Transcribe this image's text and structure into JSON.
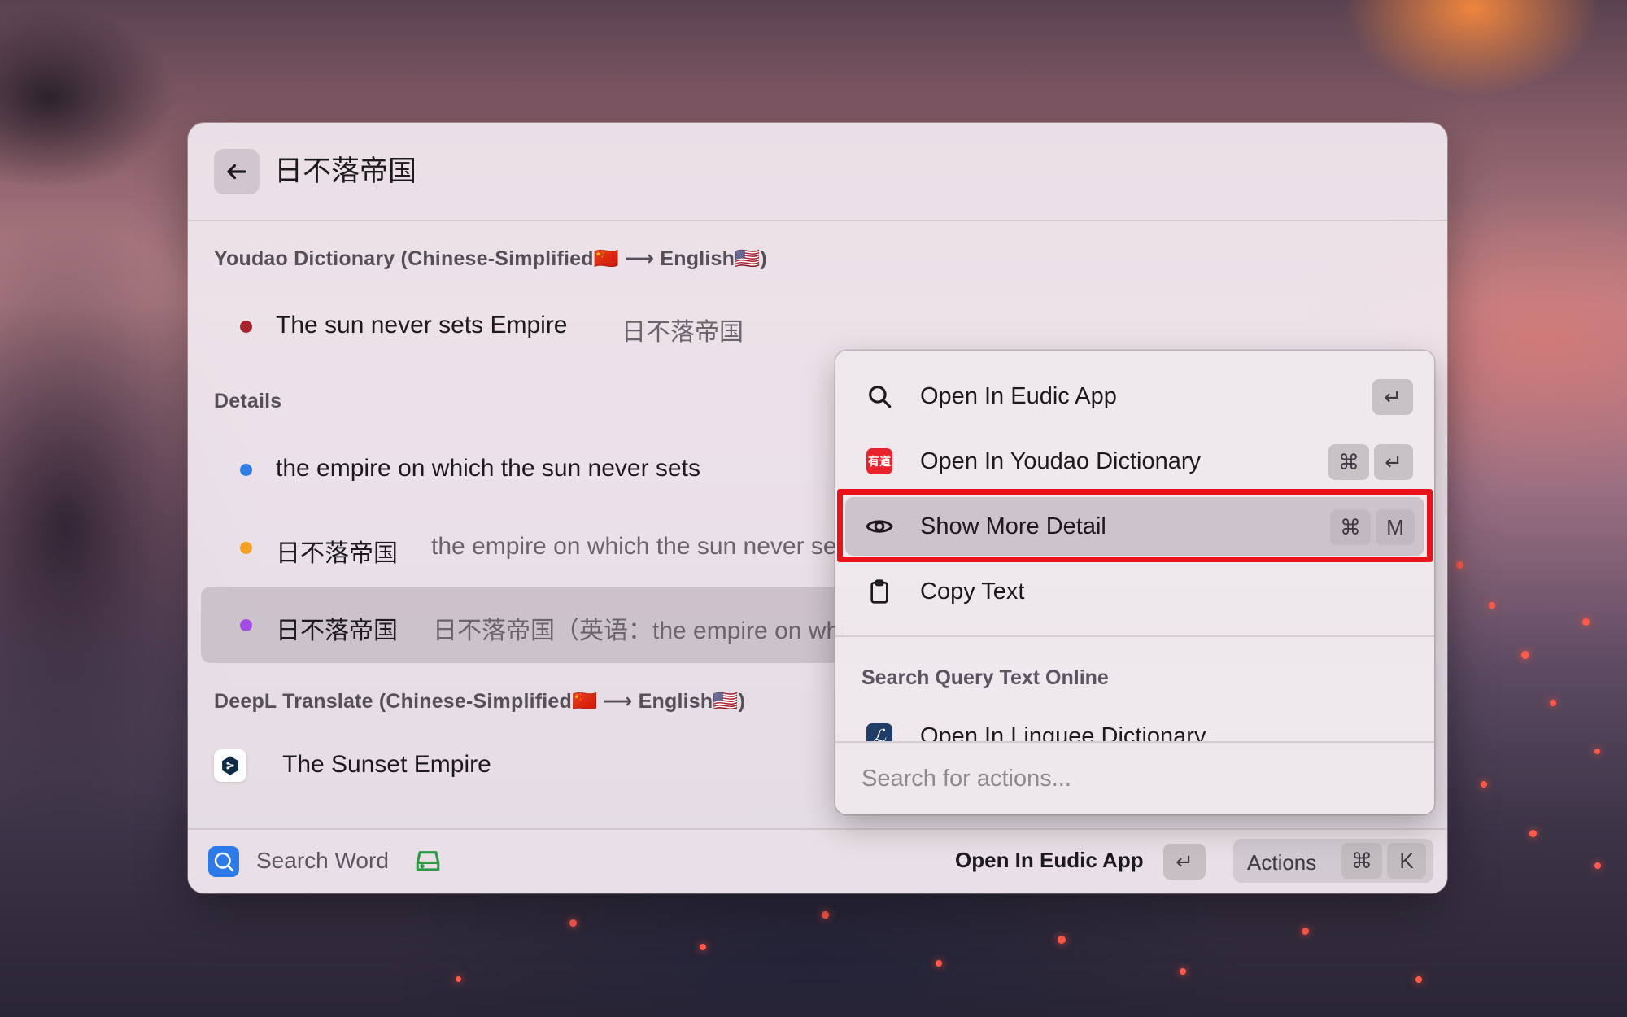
{
  "header": {
    "query": "日不落帝国"
  },
  "sections": {
    "youdao": "Youdao Dictionary   (Chinese-Simplified🇨🇳 ⟶ English🇺🇸)",
    "details": "Details",
    "deepl": "DeepL Translate   (Chinese-Simplified🇨🇳 ⟶ English🇺🇸)"
  },
  "results": {
    "youdao_main": {
      "title": "The sun never sets Empire",
      "subtitle": "日不落帝国",
      "dot_color": "#a8222e"
    },
    "detail_1": {
      "title": "the empire on which the sun never sets",
      "dot_color": "#2f7ee6"
    },
    "detail_2": {
      "title": "日不落帝国",
      "subtitle": "the empire on which the sun never se",
      "dot_color": "#f2a120"
    },
    "detail_3": {
      "title": "日不落帝国",
      "subtitle": "日不落帝国（英语：the empire on whi",
      "dot_color": "#a44ce6"
    },
    "deepl_main": {
      "title": "The Sunset Empire"
    }
  },
  "footer": {
    "app_name": "Search Word",
    "primary_action": "Open In Eudic App",
    "primary_key": "↵",
    "actions_label": "Actions",
    "actions_keys": [
      "⌘",
      "K"
    ]
  },
  "action_panel": {
    "items": [
      {
        "label": "Open In Eudic App",
        "icon": "search-icon",
        "keys": [
          "↵"
        ]
      },
      {
        "label": "Open In Youdao Dictionary",
        "icon": "youdao-icon",
        "icon_text": "有道",
        "keys": [
          "⌘",
          "↵"
        ]
      },
      {
        "label": "Show More Detail",
        "icon": "eye-icon",
        "keys": [
          "⌘",
          "M"
        ]
      },
      {
        "label": "Copy Text",
        "icon": "clipboard-icon",
        "keys": []
      }
    ],
    "section_title": "Search Query Text Online",
    "online_items": [
      {
        "label": "Open In Linguee Dictionary",
        "icon": "linguee-icon"
      }
    ],
    "search_placeholder": "Search for actions...",
    "search_value": ""
  },
  "colors": {
    "highlight": "#e8121b",
    "accent": "#2d7be8"
  }
}
